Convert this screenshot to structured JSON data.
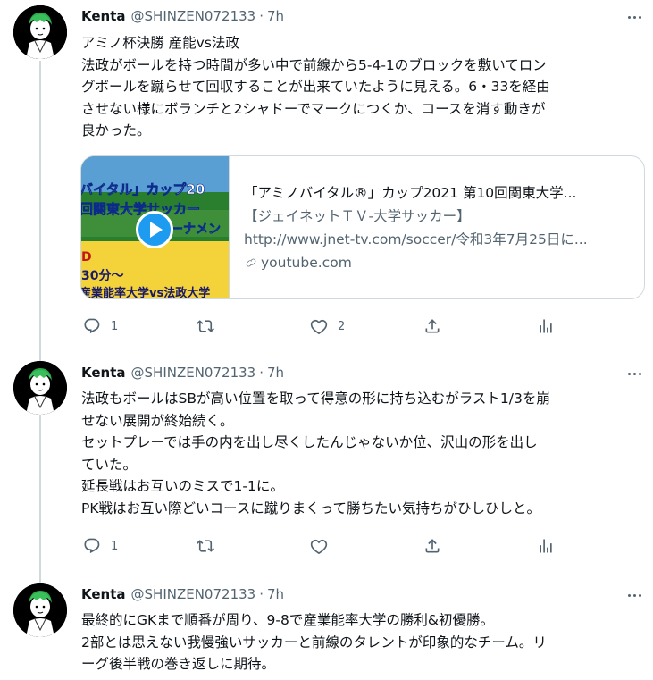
{
  "tweets": [
    {
      "name": "Kenta",
      "handle": "@SHINZEN072133",
      "time": "7h",
      "lines": [
        "アミノ杯決勝 産能vs法政",
        "法政がボールを持つ時間が多い中で前線から5-4-1のブロックを敷いてロン",
        "グボールを蹴らせて回収することが出来ていたように見える。6・33を経由",
        "させない様にボランチと2シャドーでマークにつくか、コースを消す動きが",
        "良かった。"
      ],
      "card": {
        "title": "「アミノバイタル®」カップ2021 第10回関東大学...",
        "description": "【ジェイネットＴＶ-大学サッカー】",
        "url": "http://www.jnet-tv.com/soccer/令和3年7月25日に...",
        "domain": "youtube.com",
        "thumb_lines": [
          "バイタル」カップ20",
          "回関東大学サッカー",
          "ーナメン",
          "D",
          "30分～",
          "産業能率大学vs法政大学"
        ]
      },
      "reply_count": "1",
      "retweet_count": "",
      "like_count": "2"
    },
    {
      "name": "Kenta",
      "handle": "@SHINZEN072133",
      "time": "7h",
      "lines": [
        "法政もボールはSBが高い位置を取って得意の形に持ち込むがラスト1/3を崩",
        "せない展開が終始続く。",
        "セットプレーでは手の内を出し尽くしたんじゃないか位、沢山の形を出し",
        "ていた。",
        "延長戦はお互いのミスで1-1に。",
        "PK戦はお互い際どいコースに蹴りまくって勝ちたい気持ちがひしひしと。"
      ],
      "reply_count": "1",
      "retweet_count": "",
      "like_count": ""
    },
    {
      "name": "Kenta",
      "handle": "@SHINZEN072133",
      "time": "7h",
      "lines": [
        "最終的にGKまで順番が周り、9-8で産業能率大学の勝利&初優勝。",
        "2部とは思えない我慢強いサッカーと前線のタレントが印象的なチーム。リ",
        "ーグ後半戦の巻き返しに期待。"
      ]
    }
  ],
  "colors": {
    "accent": "#1d9bf0",
    "secondary_text": "#536471",
    "border": "#cfd9de"
  }
}
